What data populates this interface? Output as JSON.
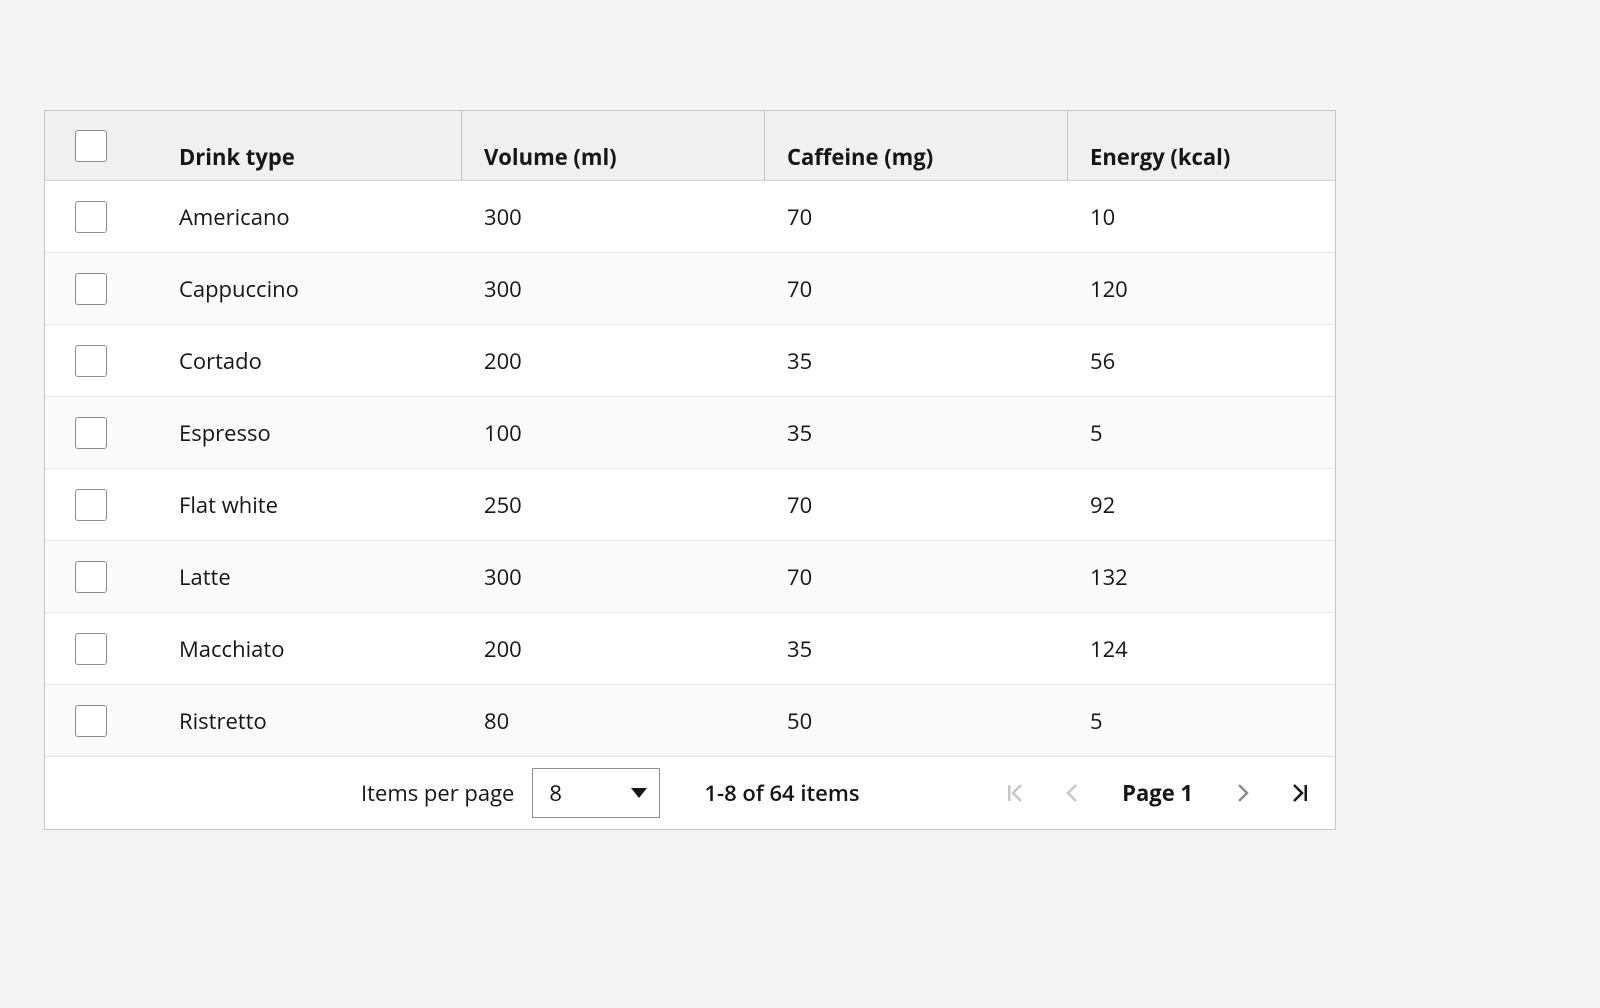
{
  "table": {
    "columns": [
      {
        "label": "Drink type"
      },
      {
        "label": "Volume (ml)"
      },
      {
        "label": "Caffeine (mg)"
      },
      {
        "label": "Energy (kcal)"
      }
    ],
    "rows": [
      {
        "drink": "Americano",
        "volume": "300",
        "caffeine": "70",
        "energy": "10"
      },
      {
        "drink": "Cappuccino",
        "volume": "300",
        "caffeine": "70",
        "energy": "120"
      },
      {
        "drink": "Cortado",
        "volume": "200",
        "caffeine": "35",
        "energy": "56"
      },
      {
        "drink": "Espresso",
        "volume": "100",
        "caffeine": "35",
        "energy": "5"
      },
      {
        "drink": "Flat white",
        "volume": "250",
        "caffeine": "70",
        "energy": "92"
      },
      {
        "drink": "Latte",
        "volume": "300",
        "caffeine": "70",
        "energy": "132"
      },
      {
        "drink": "Macchiato",
        "volume": "200",
        "caffeine": "35",
        "energy": "124"
      },
      {
        "drink": "Ristretto",
        "volume": "80",
        "caffeine": "50",
        "energy": "5"
      }
    ]
  },
  "pagination": {
    "items_per_page_label": "Items per page",
    "items_per_page_value": "8",
    "range_text": "1-8 of 64 items",
    "page_label": "Page 1"
  }
}
